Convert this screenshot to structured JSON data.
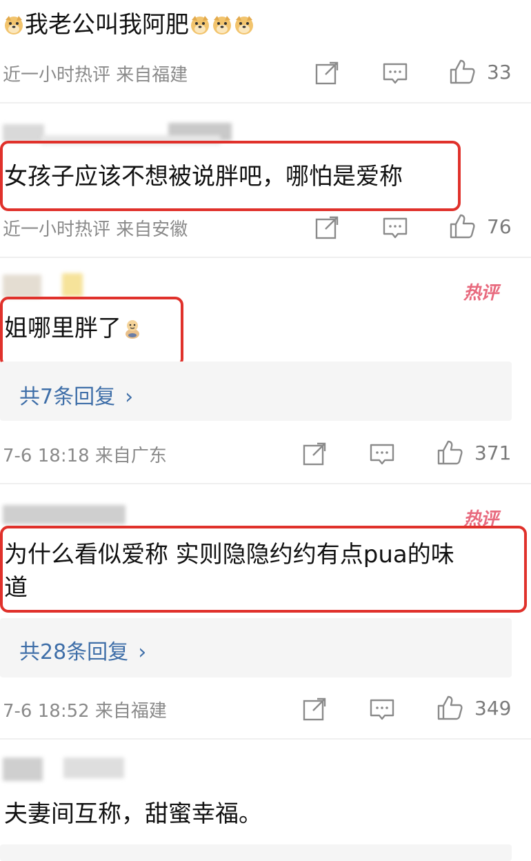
{
  "comments": [
    {
      "text": "我老公叫我阿肥",
      "meta": "近一小时热评 来自福建",
      "likes": "33"
    },
    {
      "text": "女孩子应该不想被说胖吧，哪怕是爱称",
      "meta": "近一小时热评 来自安徽",
      "likes": "76"
    },
    {
      "text": "姐哪里胖了",
      "hot_badge": "热评",
      "replies_label": "共7条回复",
      "meta": "7-6 18:18 来自广东",
      "likes": "371"
    },
    {
      "text_line1": "为什么看似爱称 实则隐隐约约有点pua的味",
      "text_line2": "道",
      "hot_badge": "热评",
      "replies_label": "共28条回复",
      "meta": "7-6 18:52 来自福建",
      "likes": "349"
    },
    {
      "text": "夫妻间互称，甜蜜幸福。"
    }
  ],
  "icons": {
    "share": "share-icon",
    "reply": "comment-icon",
    "like": "thumbs-up-icon",
    "emoji_doge": "doge-emoji-icon",
    "emoji_chubby": "chubby-baby-emoji-icon",
    "chevron": "chevron-right-icon"
  },
  "colors": {
    "highlight_border": "#e0312b",
    "reply_link": "#3e6ea8",
    "hot_badge": "#e86a7e",
    "meta_text": "#8a8a8a"
  }
}
